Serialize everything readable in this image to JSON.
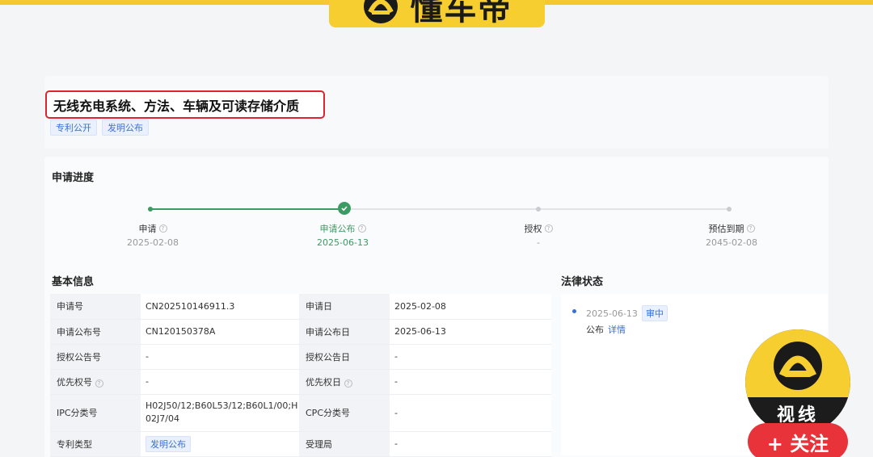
{
  "brand": {
    "logo_text": "懂车帝",
    "accent": "#f7ce2f"
  },
  "patent": {
    "title": "无线充电系统、方法、车辆及可读存储介质",
    "tags": [
      "专利公开",
      "发明公布"
    ]
  },
  "progress": {
    "section_title": "申请进度",
    "steps": [
      {
        "label": "申请",
        "date": "2025-02-08"
      },
      {
        "label": "申请公布",
        "date": "2025-06-13"
      },
      {
        "label": "授权",
        "date": "-"
      },
      {
        "label": "预估到期",
        "date": "2045-02-08"
      }
    ]
  },
  "basic_info": {
    "section_title": "基本信息",
    "rows": [
      {
        "k1": "申请号",
        "v1": "CN202510146911.3",
        "k2": "申请日",
        "v2": "2025-02-08"
      },
      {
        "k1": "申请公布号",
        "v1": "CN120150378A",
        "k2": "申请公布日",
        "v2": "2025-06-13"
      },
      {
        "k1": "授权公告号",
        "v1": "-",
        "k2": "授权公告日",
        "v2": "-"
      },
      {
        "k1": "优先权号",
        "v1": "-",
        "k2": "优先权日",
        "v2": "-"
      },
      {
        "k1": "IPC分类号",
        "v1": "H02J50/12;B60L53/12;B60L1/00;H02J7/04",
        "k2": "CPC分类号",
        "v2": "-"
      },
      {
        "k1": "专利类型",
        "v1": "发明公布",
        "k2": "受理局",
        "v2": "-"
      }
    ]
  },
  "legal": {
    "section_title": "法律状态",
    "date": "2025-06-13",
    "status": "审中",
    "event": "公布",
    "detail_link": "详情"
  },
  "overlay": {
    "avatar_text": "视线",
    "follow_label": "+ 关注"
  }
}
